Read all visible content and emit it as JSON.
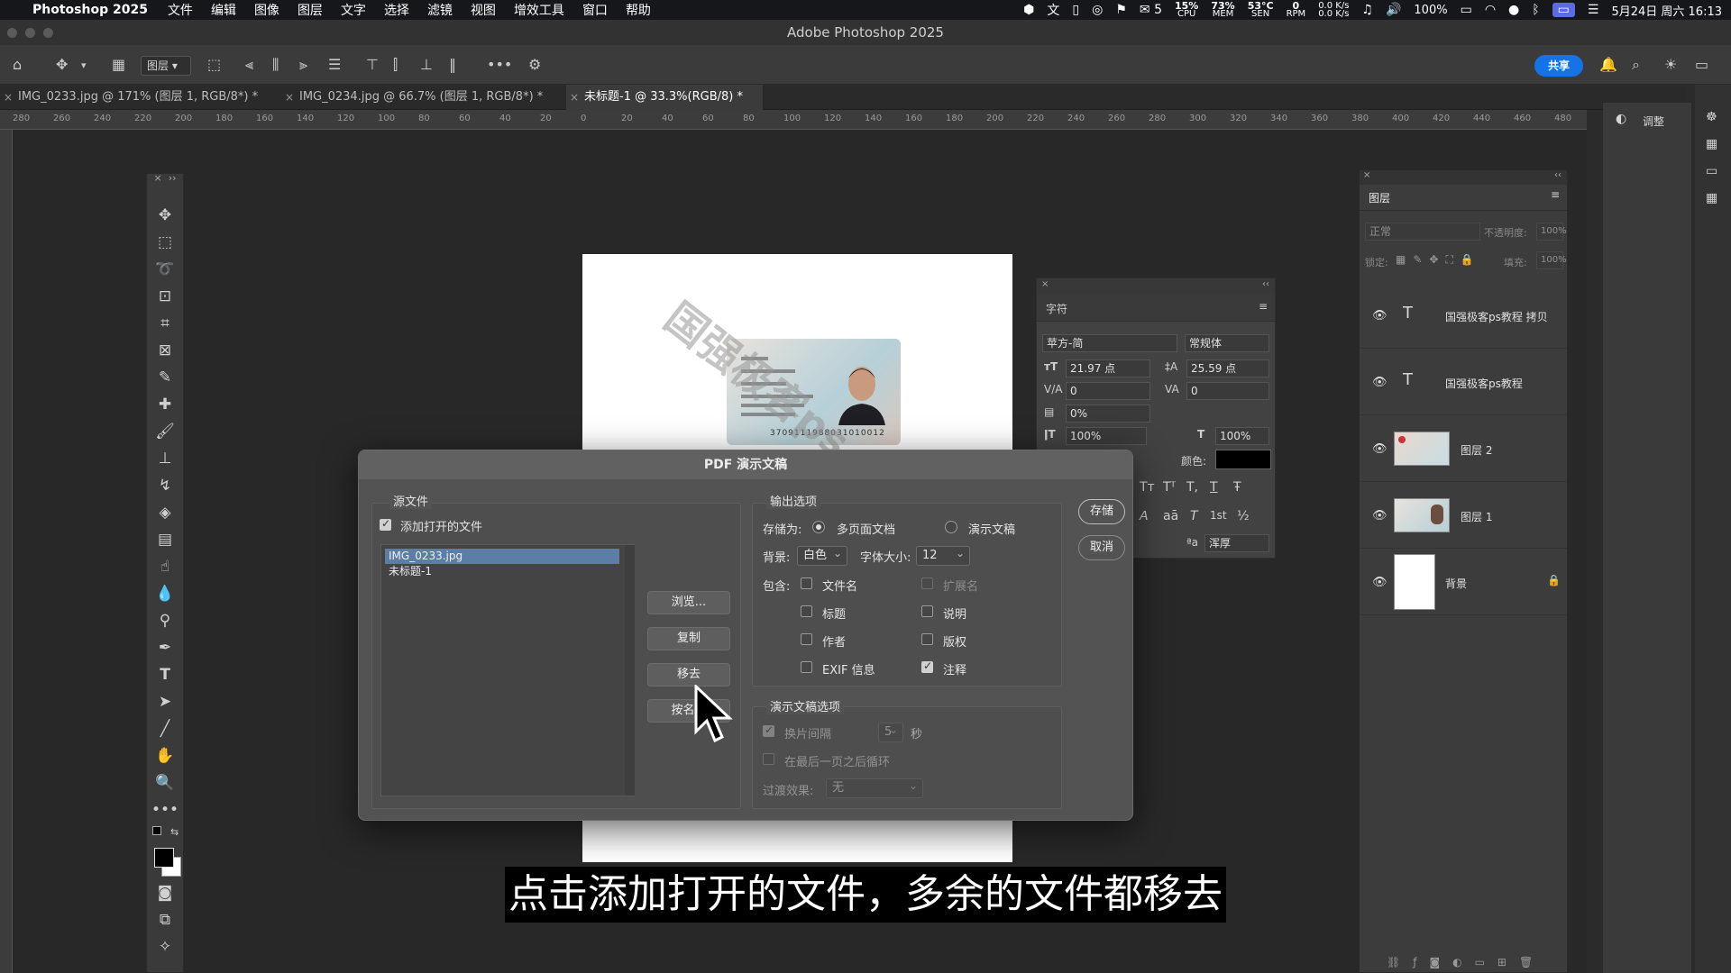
{
  "menubar": {
    "app": "Photoshop 2025",
    "items": [
      "文件",
      "编辑",
      "图像",
      "图层",
      "文字",
      "选择",
      "滤镜",
      "视图",
      "增效工具",
      "窗口",
      "帮助"
    ],
    "wechat_count": "5",
    "cpu": "15%",
    "cpu_label": "CPU",
    "mem": "73%",
    "mem_label": "MEM",
    "sen": "53°C",
    "sen_label": "SEN",
    "rpm": "0",
    "rpm_label": "RPM",
    "net_up": "0.0 K/s",
    "net_down": "0.0 K/s",
    "battery": "100%",
    "datetime": "5月24日 周六  16:13"
  },
  "window": {
    "title": "Adobe Photoshop 2025"
  },
  "optbar": {
    "layer_select": "图层",
    "share": "共享"
  },
  "tabs": [
    {
      "label": "IMG_0233.jpg @ 171% (图层 1, RGB/8*) *",
      "active": false
    },
    {
      "label": "IMG_0234.jpg @ 66.7% (图层 1, RGB/8*) *",
      "active": false
    },
    {
      "label": "未标题-1 @ 33.3%(RGB/8) *",
      "active": true
    }
  ],
  "ruler_ticks": [
    "280",
    "260",
    "240",
    "220",
    "200",
    "180",
    "160",
    "140",
    "120",
    "100",
    "80",
    "60",
    "40",
    "20",
    "0",
    "20",
    "40",
    "60",
    "80",
    "100",
    "120",
    "140",
    "160",
    "180",
    "200",
    "220",
    "240",
    "260",
    "280",
    "300",
    "320",
    "340",
    "360",
    "380",
    "400",
    "420",
    "440",
    "460",
    "480"
  ],
  "canvas": {
    "watermark": "国强极客ps",
    "id_number": "3709111988031010012"
  },
  "character_panel": {
    "title": "字符",
    "font": "苹方-简",
    "style": "常规体",
    "size": "21.97 点",
    "leading": "25.59 点",
    "kerning": "0",
    "tracking": "0",
    "scale_pct": "0%",
    "vscale": "100%",
    "hscale": "100%",
    "color_label": "颜色:",
    "aa_label": "ªa",
    "aa": "浑厚",
    "text_style_glyphs": [
      "Tт",
      "Tᵀ",
      "T,",
      "T",
      "Ŧ"
    ],
    "glyphs2": [
      "𝘈",
      "aā",
      "T",
      "1st",
      "½"
    ]
  },
  "layers_panel": {
    "title": "图层",
    "blend": "正常",
    "opacity_label": "不透明度:",
    "opacity": "100%",
    "lock_label": "锁定:",
    "fill_label": "填充:",
    "fill": "100%",
    "layers": [
      {
        "name": "国强极客ps教程 拷贝",
        "type": "text"
      },
      {
        "name": "国强极客ps教程",
        "type": "text"
      },
      {
        "name": "图层 2",
        "type": "image"
      },
      {
        "name": "图层 1",
        "type": "image"
      },
      {
        "name": "背景",
        "type": "background"
      }
    ]
  },
  "adjust_panel": {
    "title": "调整"
  },
  "dialog": {
    "title": "PDF 演示文稿",
    "source_label": "源文件",
    "add_open_files": "添加打开的文件",
    "add_open_files_checked": true,
    "files": [
      "IMG_0233.jpg",
      "未标题-1"
    ],
    "selected_file": 0,
    "btn_browse": "浏览...",
    "btn_duplicate": "复制",
    "btn_remove": "移去",
    "btn_sort": "按名称",
    "output_label": "输出选项",
    "save_as_label": "存储为:",
    "opt_multipage": "多页面文档",
    "opt_presentation": "演示文稿",
    "bg_label": "背景:",
    "bg_value": "白色",
    "fontsize_label": "字体大小:",
    "fontsize_value": "12",
    "include_label": "包含:",
    "inc_filename": "文件名",
    "inc_extension": "扩展名",
    "inc_title": "标题",
    "inc_description": "说明",
    "inc_author": "作者",
    "inc_copyright": "版权",
    "inc_exif": "EXIF 信息",
    "inc_notes": "注释",
    "present_label": "演示文稿选项",
    "advance_label": "换片间隔",
    "advance_value": "5",
    "seconds": "秒",
    "loop_label": "在最后一页之后循环",
    "transition_label": "过渡效果:",
    "transition_value": "无",
    "btn_save": "存储",
    "btn_cancel": "取消"
  },
  "subtitle": "点击添加打开的文件，多余的文件都移去"
}
